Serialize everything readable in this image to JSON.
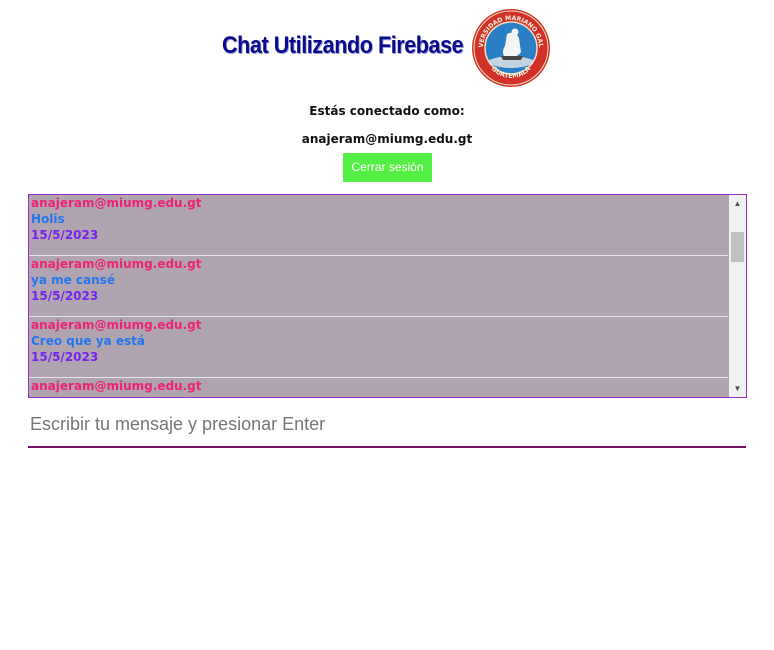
{
  "header": {
    "title": "Chat Utilizando Firebase",
    "logo_text_top": "UNIVERSIDAD MARIANO GALVEZ",
    "logo_text_bottom": "GUATEMALA"
  },
  "session": {
    "connected_label": "Estás conectado como:",
    "user_email": "anajeram@miumg.edu.gt",
    "logout_label": "Cerrar sesión"
  },
  "chat": {
    "messages": [
      {
        "user": "anajeram@miumg.edu.gt",
        "text": "Holis",
        "date": "15/5/2023"
      },
      {
        "user": "anajeram@miumg.edu.gt",
        "text": "ya me cansé",
        "date": "15/5/2023"
      },
      {
        "user": "anajeram@miumg.edu.gt",
        "text": "Creo que ya está",
        "date": "15/5/2023"
      },
      {
        "user": "anajeram@miumg.edu.gt",
        "text": "",
        "date": ""
      }
    ]
  },
  "input": {
    "placeholder": "Escribir tu mensaje y presionar Enter",
    "value": ""
  },
  "colors": {
    "title": "#0a0a8c",
    "button_bg": "#55ee44",
    "chat_bg": "#b0a4b0",
    "chat_border": "#9933cc",
    "msg_user": "#ee2277",
    "msg_text": "#2277ee",
    "msg_date": "#7722ee",
    "input_underline": "#771166"
  },
  "icons": {
    "scroll_up": "scroll-up-arrow-icon",
    "scroll_down": "scroll-down-arrow-icon",
    "logo": "university-seal-logo"
  }
}
